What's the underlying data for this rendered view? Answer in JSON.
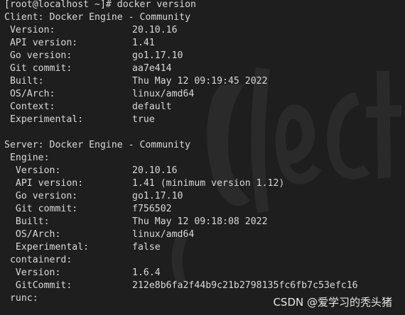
{
  "terminal": {
    "lines": [
      {
        "key": "[root@localhost ~]# docker version",
        "val": ""
      },
      {
        "key": "Client: Docker Engine - Community",
        "val": ""
      },
      {
        "key": " Version:",
        "val": "20.10.16"
      },
      {
        "key": " API version:",
        "val": "1.41"
      },
      {
        "key": " Go version:",
        "val": "go1.17.10"
      },
      {
        "key": " Git commit:",
        "val": "aa7e414"
      },
      {
        "key": " Built:",
        "val": "Thu May 12 09:19:45 2022"
      },
      {
        "key": " OS/Arch:",
        "val": "linux/amd64"
      },
      {
        "key": " Context:",
        "val": "default"
      },
      {
        "key": " Experimental:",
        "val": "true"
      },
      {
        "key": "",
        "val": ""
      },
      {
        "key": "Server: Docker Engine - Community",
        "val": ""
      },
      {
        "key": " Engine:",
        "val": ""
      },
      {
        "key": "  Version:",
        "val": "20.10.16"
      },
      {
        "key": "  API version:",
        "val": "1.41 (minimum version 1.12)"
      },
      {
        "key": "  Go version:",
        "val": "go1.17.10"
      },
      {
        "key": "  Git commit:",
        "val": "f756502"
      },
      {
        "key": "  Built:",
        "val": "Thu May 12 09:18:08 2022"
      },
      {
        "key": "  OS/Arch:",
        "val": "linux/amd64"
      },
      {
        "key": "  Experimental:",
        "val": "false"
      },
      {
        "key": " containerd:",
        "val": ""
      },
      {
        "key": "  Version:",
        "val": "1.6.4"
      },
      {
        "key": "  GitCommit:",
        "val": "212e8b6fa2f44b9c21b2798135fc6fb7c53efc16"
      },
      {
        "key": " runc:",
        "val": ""
      }
    ]
  },
  "watermark": {
    "text": "CSDN @爱学习的秃头猪"
  },
  "colors": {
    "background": "#1e1e1e",
    "text": "#d9d9d9"
  }
}
